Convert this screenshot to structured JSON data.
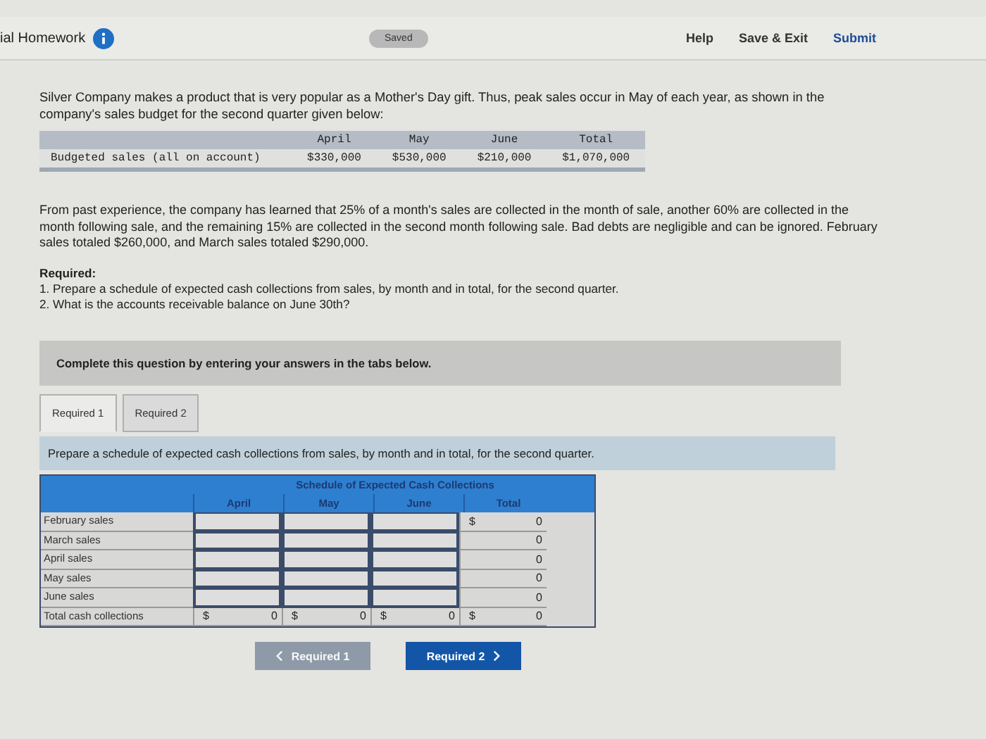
{
  "header": {
    "title": "ial Homework",
    "status": "Saved",
    "links": [
      "Help",
      "Save & Exit",
      "Submit"
    ]
  },
  "intro": "Silver Company makes a product that is very popular as a Mother's Day gift. Thus, peak sales occur in May of each year, as shown in the company's sales budget for the second quarter given below:",
  "budget_table": {
    "columns": [
      "April",
      "May",
      "June",
      "Total"
    ],
    "row_label": "Budgeted sales (all on account)",
    "values": [
      "$330,000",
      "$530,000",
      "$210,000",
      "$1,070,000"
    ]
  },
  "paragraph": "From past experience, the company has learned that 25% of a month's sales are collected in the month of sale, another 60% are collected in the month following sale, and the remaining 15% are collected in the second month following sale. Bad debts are negligible and can be ignored. February sales totaled $260,000, and March sales totaled $290,000.",
  "required": {
    "heading": "Required:",
    "items": [
      "1. Prepare a schedule of expected cash collections from sales, by month and in total, for the second quarter.",
      "2. What is the accounts receivable balance on June 30th?"
    ]
  },
  "instruction": "Complete this question by entering your answers in the tabs below.",
  "tabs": [
    {
      "label": "Required 1",
      "selected": true
    },
    {
      "label": "Required 2",
      "selected": false
    }
  ],
  "prompt": "Prepare a schedule of expected cash collections from sales, by month and in total, for the second quarter.",
  "schedule": {
    "title": "Schedule of Expected Cash Collections",
    "columns": [
      "April",
      "May",
      "June",
      "Total"
    ],
    "rows": [
      {
        "label": "February sales",
        "kind": "input",
        "cells": [
          {
            "symbol": "$",
            "value": "0"
          }
        ]
      },
      {
        "label": "March sales",
        "kind": "input",
        "cells": [
          {
            "value": "0"
          }
        ]
      },
      {
        "label": "April sales",
        "kind": "input",
        "cells": [
          {
            "value": "0"
          }
        ]
      },
      {
        "label": "May sales",
        "kind": "input",
        "cells": [
          {
            "value": "0"
          }
        ]
      },
      {
        "label": "June sales",
        "kind": "input",
        "cells": [
          {
            "value": "0"
          }
        ]
      },
      {
        "label": "Total cash collections",
        "kind": "sum",
        "cells": [
          {
            "symbol": "$",
            "value": "0"
          },
          {
            "symbol": "$",
            "value": "0"
          },
          {
            "symbol": "$",
            "value": "0"
          },
          {
            "symbol": "$",
            "value": "0"
          }
        ]
      }
    ]
  },
  "nav": [
    {
      "label": "Required 1",
      "kind": "prev",
      "disabled": true
    },
    {
      "label": "Required 2",
      "kind": "next",
      "disabled": false
    }
  ]
}
